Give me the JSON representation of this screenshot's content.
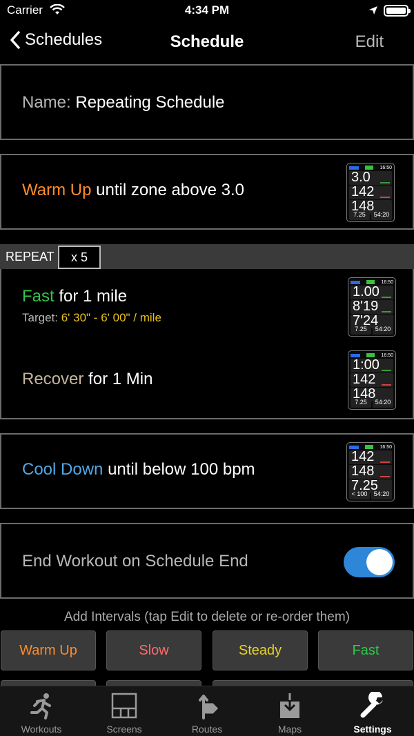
{
  "status": {
    "carrier": "Carrier",
    "time": "4:34 PM"
  },
  "nav": {
    "back": "Schedules",
    "title": "Schedule",
    "edit": "Edit"
  },
  "name_cell": {
    "label": "Name:",
    "value": "Repeating Schedule"
  },
  "warmup": {
    "type": "Warm Up",
    "detail": "until zone above 3.0",
    "watch": {
      "r1": "3.0",
      "r2": "142",
      "r3": "148",
      "f1": "7.25",
      "f2": "54:20",
      "time": "16:50"
    }
  },
  "repeat": {
    "label": "REPEAT",
    "count": "x 5"
  },
  "fast": {
    "type": "Fast",
    "detail": "for 1 mile",
    "target_label": "Target:",
    "target_value": "6' 30\" - 6' 00\" / mile",
    "watch": {
      "r1": "1.00",
      "r2": "8'19",
      "r3": "7'24",
      "f1": "7.25",
      "f2": "54:20",
      "time": "16:50"
    }
  },
  "recover": {
    "type": "Recover",
    "detail": "for 1 Min",
    "watch": {
      "r1": "1:00",
      "r2": "142",
      "r3": "148",
      "f1": "7.25",
      "f2": "54:20",
      "time": "16:50"
    }
  },
  "cooldown": {
    "type": "Cool Down",
    "detail": "until below 100 bpm",
    "watch": {
      "r1": "142",
      "r2": "148",
      "r3": "7.25",
      "f1": "< 100",
      "f2": "54:20",
      "time": "16:50"
    }
  },
  "end_workout": {
    "label": "End Workout on Schedule End",
    "enabled": true
  },
  "add_intervals": {
    "hint": "Add Intervals (tap Edit to delete or re-order them)",
    "buttons": [
      "Warm Up",
      "Slow",
      "Steady",
      "Fast"
    ]
  },
  "tabs": [
    "Workouts",
    "Screens",
    "Routes",
    "Maps",
    "Settings"
  ],
  "colors": {
    "warmup": "#ff8c2a",
    "slow": "#ff6a6a",
    "steady": "#e8d22a",
    "fast": "#2ec84a",
    "recover": "#c8b49a",
    "cooldown": "#52a8e8",
    "toggle": "#2e86d8"
  }
}
